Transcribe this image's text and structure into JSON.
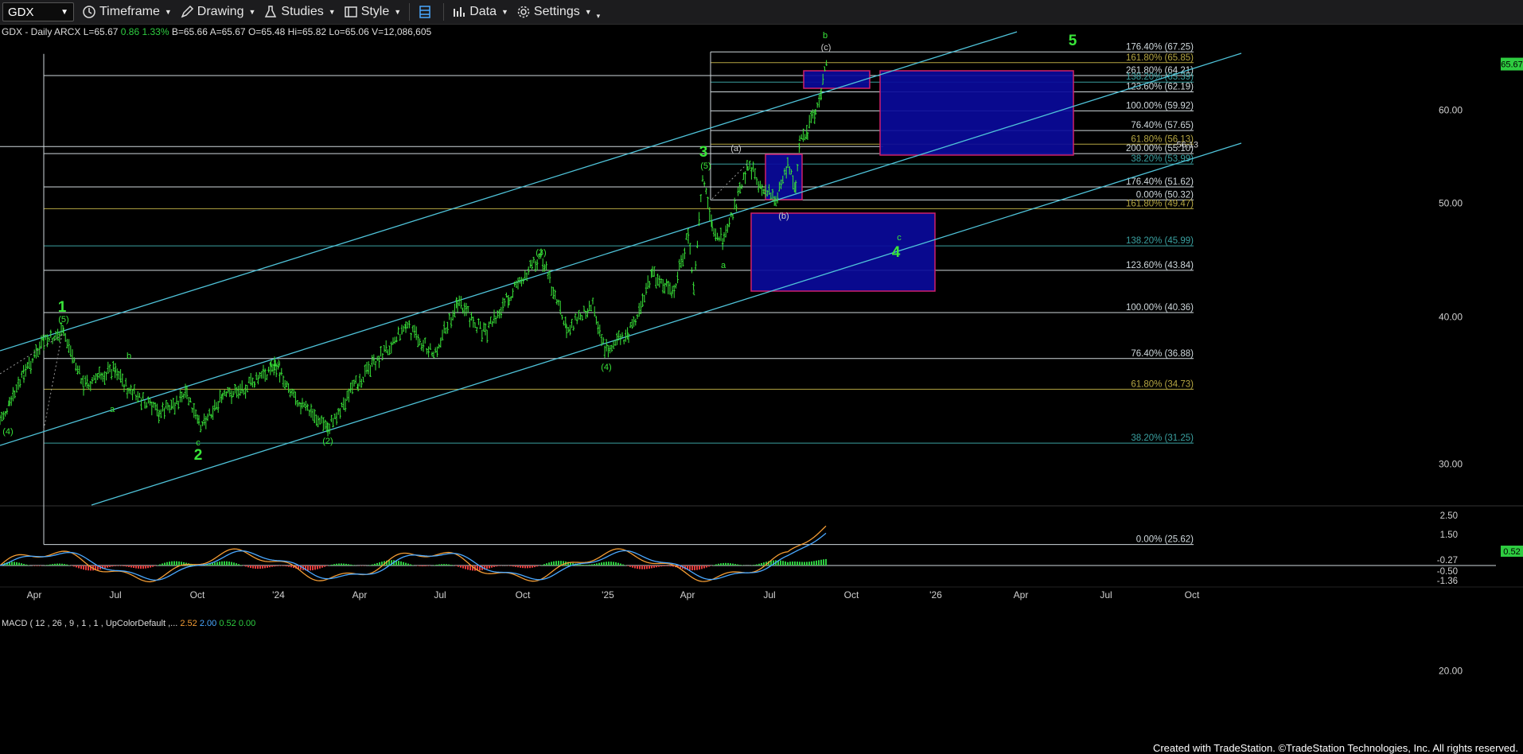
{
  "toolbar": {
    "symbol": "GDX",
    "timeframe": "Timeframe",
    "drawing": "Drawing",
    "studies": "Studies",
    "style": "Style",
    "data": "Data",
    "settings": "Settings"
  },
  "header": {
    "name": "GDX - Daily",
    "exchange": "ARCX",
    "last": "L=65.67",
    "change": "0.86",
    "change_pct": "1.33%",
    "bid": "B=65.66",
    "ask": "A=65.67",
    "open": "O=65.48",
    "high": "Hi=65.82",
    "low": "Lo=65.06",
    "volume": "V=12,086,605"
  },
  "price_axis": [
    "60.00",
    "50.00",
    "40.00",
    "30.00",
    "20.00"
  ],
  "last_price_tag": "65.67",
  "fib_levels": [
    {
      "label": "176.40% (67.25)",
      "price": 67.25,
      "color": "#cfd8dc"
    },
    {
      "label": "161.80% (65.85)",
      "price": 65.85,
      "color": "#b5a642"
    },
    {
      "label": "261.80% (64.21)",
      "price": 64.21,
      "color": "#cfd8dc"
    },
    {
      "label": "138.20% (63.39)",
      "price": 63.39,
      "color": "#3aa0a0"
    },
    {
      "label": "123.60% (62.19)",
      "price": 62.19,
      "color": "#cfd8dc"
    },
    {
      "label": "100.00% (59.92)",
      "price": 59.92,
      "color": "#cfd8dc"
    },
    {
      "label": "76.40% (57.65)",
      "price": 57.65,
      "color": "#cfd8dc"
    },
    {
      "label": "61.80% (56.13)",
      "price": 56.13,
      "color": "#b5a642"
    },
    {
      "label": "200.00% (55.10)",
      "price": 55.1,
      "color": "#cfd8dc"
    },
    {
      "label": "38.20% (53.99)",
      "price": 53.99,
      "color": "#3aa0a0"
    },
    {
      "label": "176.40% (51.62)",
      "price": 51.62,
      "color": "#cfd8dc"
    },
    {
      "label": "0.00% (50.32)",
      "price": 50.32,
      "color": "#cfd8dc"
    },
    {
      "label": "161.80% (49.47)",
      "price": 49.47,
      "color": "#b5a642"
    },
    {
      "label": "138.20% (45.99)",
      "price": 45.99,
      "color": "#3aa0a0"
    },
    {
      "label": "123.60% (43.84)",
      "price": 43.84,
      "color": "#cfd8dc"
    },
    {
      "label": "100.00% (40.36)",
      "price": 40.36,
      "color": "#cfd8dc"
    },
    {
      "label": "76.40% (36.88)",
      "price": 36.88,
      "color": "#cfd8dc"
    },
    {
      "label": "61.80% (34.73)",
      "price": 34.73,
      "color": "#b5a642"
    },
    {
      "label": "38.20% (31.25)",
      "price": 31.25,
      "color": "#3aa0a0"
    },
    {
      "label": "0.00% (25.62)",
      "price": 25.62,
      "color": "#cfd8dc"
    }
  ],
  "extra_price_label": "56.13",
  "wave_labels": [
    {
      "text": "1",
      "color": "#39e639",
      "size": "big"
    },
    {
      "text": "(5)",
      "color": "#39e639",
      "size": "small"
    },
    {
      "text": "(4)",
      "color": "#39e639",
      "size": "small"
    },
    {
      "text": "b",
      "color": "#39e639",
      "size": "small"
    },
    {
      "text": "a",
      "color": "#39e639",
      "size": "small"
    },
    {
      "text": "c",
      "color": "#39e639",
      "size": "small"
    },
    {
      "text": "2",
      "color": "#39e639",
      "size": "big"
    },
    {
      "text": "(1)",
      "color": "#39e639",
      "size": "small"
    },
    {
      "text": "(2)",
      "color": "#39e639",
      "size": "small"
    },
    {
      "text": "(3)",
      "color": "#39e639",
      "size": "small"
    },
    {
      "text": "(4)",
      "color": "#39e639",
      "size": "small"
    },
    {
      "text": "3",
      "color": "#39e639",
      "size": "big"
    },
    {
      "text": "(5)",
      "color": "#39e639",
      "size": "small"
    },
    {
      "text": "a",
      "color": "#39e639",
      "size": "small"
    },
    {
      "text": "(a)",
      "color": "#cccccc",
      "size": "small"
    },
    {
      "text": "(b)",
      "color": "#cccccc",
      "size": "small"
    },
    {
      "text": "(c)",
      "color": "#cccccc",
      "size": "small"
    },
    {
      "text": "b",
      "color": "#39e639",
      "size": "small"
    },
    {
      "text": "c",
      "color": "#39e639",
      "size": "small"
    },
    {
      "text": "4",
      "color": "#39e639",
      "size": "big"
    },
    {
      "text": "5",
      "color": "#39e639",
      "size": "big"
    }
  ],
  "x_axis": [
    "Apr",
    "Jul",
    "Oct",
    "'24",
    "Apr",
    "Jul",
    "Oct",
    "'25",
    "Apr",
    "Jul",
    "Oct",
    "'26",
    "Apr",
    "Jul",
    "Oct"
  ],
  "macd": {
    "title": "MACD ( 12 , 26 , 9 , 1 , 1 , UpColorDefault ,...",
    "macd": "2.52",
    "signal": "2.00",
    "hist": "0.52",
    "zero": "0.00",
    "axis": [
      "2.50",
      "1.50",
      "-0.27",
      "-0.50",
      "-1.36"
    ],
    "last_tag": "0.52"
  },
  "footer": "Created with TradeStation. ©TradeStation Technologies, Inc. All rights reserved.",
  "colors": {
    "up": "#39e639",
    "channel": "#4fc3d9",
    "box_fill": "#0a0a9a",
    "box_border": "#d0206a",
    "macd": "#f39c34",
    "signal": "#4aa8ff"
  }
}
